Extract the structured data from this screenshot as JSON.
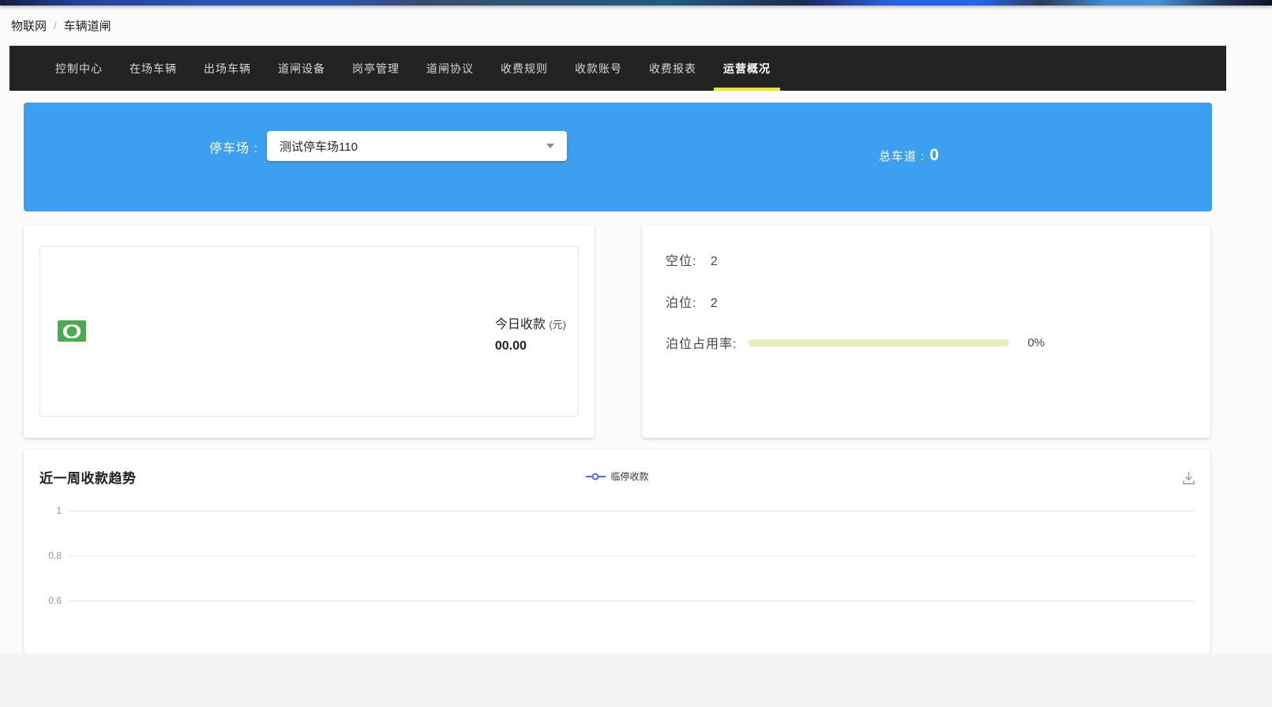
{
  "breadcrumb": {
    "root": "物联网",
    "separator": "/",
    "current": "车辆道闸"
  },
  "nav": {
    "bg_color": "#232323",
    "active_underline_color": "#efe13c",
    "active_index": 9,
    "tabs": [
      {
        "label": "控制中心"
      },
      {
        "label": "在场车辆"
      },
      {
        "label": "出场车辆"
      },
      {
        "label": "道闸设备"
      },
      {
        "label": "岗亭管理"
      },
      {
        "label": "道闸协议"
      },
      {
        "label": "收费规则"
      },
      {
        "label": "收款账号"
      },
      {
        "label": "收费报表"
      },
      {
        "label": "运营概况"
      }
    ]
  },
  "banner": {
    "bg_color": "#3d9ff0",
    "parking_label": "停车场 :",
    "parking_select_value": "测试停车场110",
    "total_lanes_label": "总车道 :",
    "total_lanes_value": "0"
  },
  "today_card": {
    "icon": "banknote-icon",
    "icon_color": "#4cab52",
    "title": "今日收款",
    "unit": "(元)",
    "amount": "00.00"
  },
  "status_card": {
    "empty_label": "空位:",
    "empty_value": "2",
    "berth_label": "泊位:",
    "berth_value": "2",
    "occupancy_label": "泊位占用率:",
    "occupancy_percent": "0%",
    "bar_track_color": "#e9edbb"
  },
  "chart_card": {
    "title": "近一周收款趋势",
    "legend_label": "临停收款",
    "legend_color": "#4a6edb",
    "download_icon": "download-icon"
  },
  "chart_data": {
    "type": "line",
    "title": "近一周收款趋势",
    "categories": [],
    "series": [
      {
        "name": "临停收款",
        "color": "#4a6edb",
        "values": []
      }
    ],
    "ylim": [
      0,
      1
    ],
    "visible_yticks": [
      "1",
      "0.8",
      "0.6"
    ],
    "grid": true,
    "legend_position": "top-center",
    "xlabel": "",
    "ylabel": ""
  }
}
